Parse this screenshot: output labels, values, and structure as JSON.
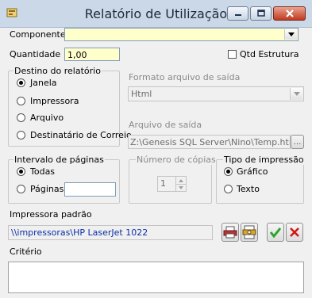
{
  "window": {
    "title": "Relatório de Utilização"
  },
  "fields": {
    "componente_label": "Componente",
    "componente_value": "",
    "quantidade_label": "Quantidade",
    "quantidade_value": "1,00",
    "qtd_estrutura_label": "Qtd Estrutura"
  },
  "destino": {
    "title": "Destino do relatório",
    "options": [
      "Janela",
      "Impressora",
      "Arquivo",
      "Destinatário de Correio"
    ],
    "selected": "Janela"
  },
  "formato": {
    "label": "Formato arquivo de saída",
    "value": "Html"
  },
  "arquivo": {
    "label": "Arquivo de saída",
    "value": "Z:\\Genesis SQL Server\\Nino\\Temp.html",
    "browse_label": "..."
  },
  "paginas": {
    "title": "Intervalo de páginas",
    "options": [
      "Todas",
      "Páginas"
    ],
    "selected": "Todas",
    "pages_value": ""
  },
  "copias": {
    "title": "Número de cópias",
    "value": "1"
  },
  "tipo": {
    "title": "Tipo de impressão",
    "options": [
      "Gráfico",
      "Texto"
    ],
    "selected": "Gráfico"
  },
  "impressora": {
    "label": "Impressora padrão",
    "value": "\\\\impressoras\\HP LaserJet 1022"
  },
  "criterio": {
    "label": "Critério",
    "value": ""
  },
  "colors": {
    "field_highlight": "#ffffcc",
    "ok": "#2aa52a",
    "cancel": "#d01818",
    "printer_link": "#0b2ea8"
  }
}
